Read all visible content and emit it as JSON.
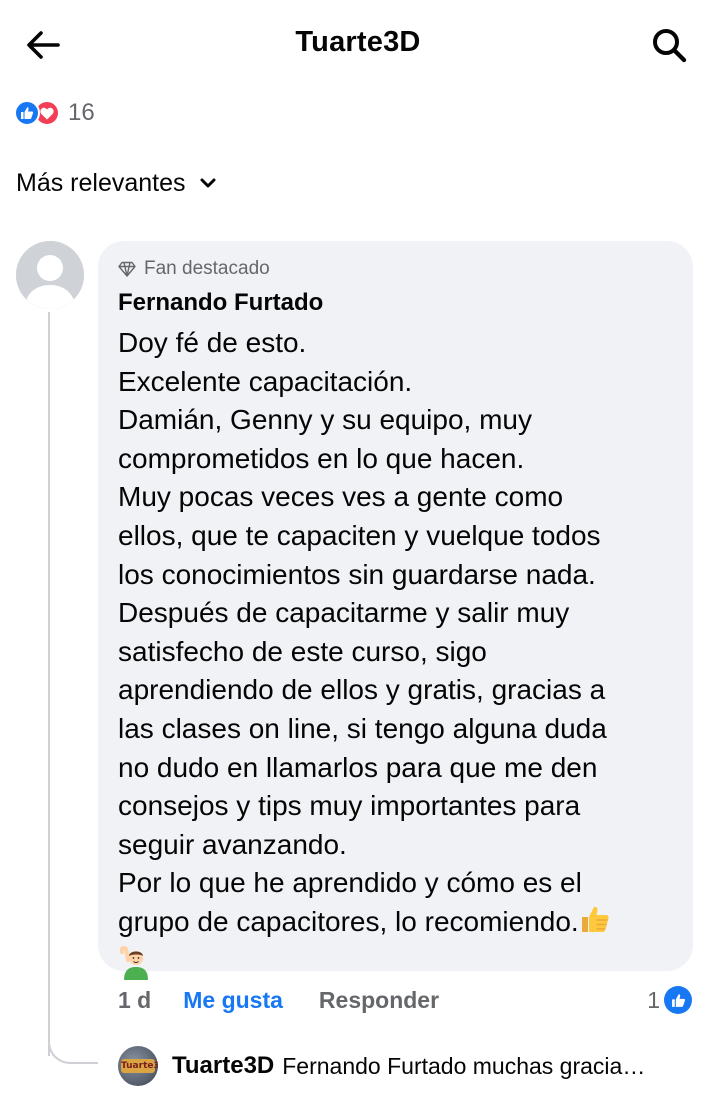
{
  "header": {
    "title": "Tuarte3D",
    "back_icon": "arrow-left-icon",
    "search_icon": "search-icon"
  },
  "reactions": {
    "types": [
      "like",
      "love"
    ],
    "count": "16"
  },
  "sort": {
    "label": "Más relevantes",
    "icon": "chevron-down-icon"
  },
  "comment": {
    "badge": "Fan destacado",
    "author": "Fernando Furtado",
    "lines": [
      "Doy fé de esto.",
      "Excelente capacitación.",
      "Damián, Genny y su equipo, muy",
      "comprometidos en lo que hacen.",
      "Muy pocas veces ves a gente como",
      "ellos, que te capaciten y vuelque todos",
      "los conocimientos sin guardarse nada.",
      "Después de capacitarme y salir muy",
      "satisfecho de este curso, sigo",
      "aprendiendo de ellos y gratis, gracias a",
      "las clases on line, si tengo alguna duda",
      "no dudo en llamarlos para que me den",
      "consejos y tips muy importantes para",
      "seguir avanzando.",
      "Por lo que he aprendido y cómo es el",
      "grupo de capacitores, lo recomiendo."
    ],
    "time": "1 d",
    "like_label": "Me gusta",
    "reply_label": "Responder",
    "like_count": "1"
  },
  "reply": {
    "author": "Tuarte3D",
    "snippet": "Fernando Furtado muchas gracia…",
    "avatar_text": "Tuarte3D"
  },
  "colors": {
    "accent": "#1877f2",
    "love": "#f33e58",
    "bubble": "#f0f2f5",
    "muted": "#65676b",
    "text": "#050505"
  }
}
